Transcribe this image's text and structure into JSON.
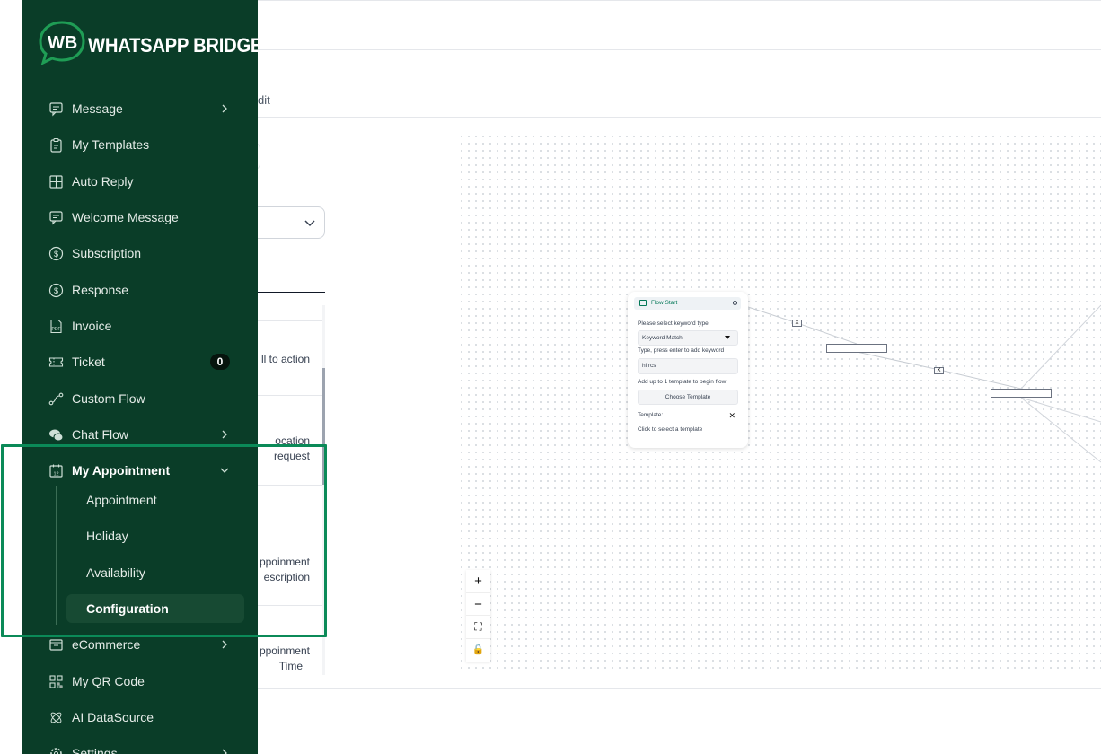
{
  "app": {
    "brand": "WHATSAPP BRIDGE",
    "logo_letters": "WB"
  },
  "sidebar": {
    "items": [
      {
        "label": "Message",
        "icon": "message-square-icon",
        "has_chevron": true
      },
      {
        "label": "My Templates",
        "icon": "clipboard-icon"
      },
      {
        "label": "Auto Reply",
        "icon": "grid-icon"
      },
      {
        "label": "Welcome Message",
        "icon": "message-square-icon"
      },
      {
        "label": "Subscription",
        "icon": "dollar-circle-icon"
      },
      {
        "label": "Response",
        "icon": "dollar-circle-icon"
      },
      {
        "label": "Invoice",
        "icon": "pdf-file-icon"
      },
      {
        "label": "Ticket",
        "icon": "ticket-icon",
        "badge": "0"
      },
      {
        "label": "Custom Flow",
        "icon": "flow-icon"
      },
      {
        "label": "Chat Flow",
        "icon": "chat-bubbles-icon",
        "has_chevron": true
      },
      {
        "label": "My Appointment",
        "icon": "calendar-icon",
        "expanded": true
      },
      {
        "label": "eCommerce",
        "icon": "store-icon",
        "has_chevron": true
      },
      {
        "label": "My QR Code",
        "icon": "qr-code-icon"
      },
      {
        "label": "AI DataSource",
        "icon": "atom-icon"
      },
      {
        "label": "Settings",
        "icon": "gear-icon",
        "has_chevron": true
      }
    ],
    "appointment_sub": [
      {
        "label": "Appointment"
      },
      {
        "label": "Holiday"
      },
      {
        "label": "Availability"
      },
      {
        "label": "Configuration",
        "selected": true
      }
    ]
  },
  "page": {
    "tab_fragment": "dit",
    "list_fragments": [
      "ll to action",
      "ocation",
      "request",
      "ppoinment",
      "escription",
      "ppoinment",
      "Time"
    ]
  },
  "flow_node": {
    "title": "Flow Start",
    "keyword_type_label": "Please select keyword type",
    "keyword_type_value": "Keyword Match",
    "keyword_hint": "Type, press enter to add keyword",
    "keyword_value": "hi rcs",
    "template_hint": "Add up to 1 template to begin flow",
    "choose_button": "Choose Template",
    "template_label": "Template:",
    "template_close": "✕",
    "template_cta": "Click to select a template"
  },
  "edge_remove_glyph": "X",
  "zoom_controls": {
    "zoom_in": "+",
    "zoom_out": "−",
    "fit": "⛶",
    "lock": "🔒"
  },
  "colors": {
    "sidebar_bg": "#0a3d28",
    "highlight_border": "#0b8a58",
    "accent": "#047857"
  }
}
